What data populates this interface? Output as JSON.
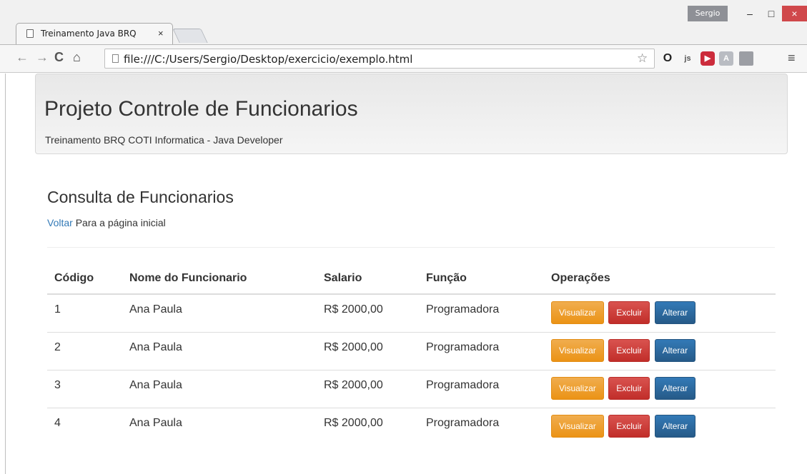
{
  "browser": {
    "tab_title": "Treinamento Java BRQ",
    "tab_close": "×",
    "user_name": "Sergio",
    "url": "file:///C:/Users/Sergio/Desktop/exercicio/exemplo.html",
    "window_min": "–",
    "window_max": "□",
    "window_close": "×",
    "icons": [
      "back-arrow",
      "forward-arrow",
      "reload",
      "home",
      "page",
      "star",
      "opera",
      "js",
      "red-extension",
      "angular",
      "extension",
      "menu"
    ]
  },
  "jumbotron": {
    "title": "Projeto Controle de Funcionarios",
    "subtitle": "Treinamento BRQ COTI Informatica - Java Developer"
  },
  "page": {
    "heading": "Consulta de Funcionarios",
    "back_link": "Voltar",
    "back_text": " Para a página inicial"
  },
  "table": {
    "headers": [
      "Código",
      "Nome do Funcionario",
      "Salario",
      "Função",
      "Operações"
    ],
    "rows": [
      {
        "code": "1",
        "name": "Ana Paula",
        "salary": "R$ 2000,00",
        "role": "Programadora"
      },
      {
        "code": "2",
        "name": "Ana Paula",
        "salary": "R$ 2000,00",
        "role": "Programadora"
      },
      {
        "code": "3",
        "name": "Ana Paula",
        "salary": "R$ 2000,00",
        "role": "Programadora"
      },
      {
        "code": "4",
        "name": "Ana Paula",
        "salary": "R$ 2000,00",
        "role": "Programadora"
      }
    ],
    "actions": {
      "view": "Visualizar",
      "delete": "Excluir",
      "edit": "Alterar"
    }
  },
  "colors": {
    "warning": "#f0ad4e",
    "danger": "#d9534f",
    "primary": "#337ab7",
    "link": "#337ab7"
  }
}
